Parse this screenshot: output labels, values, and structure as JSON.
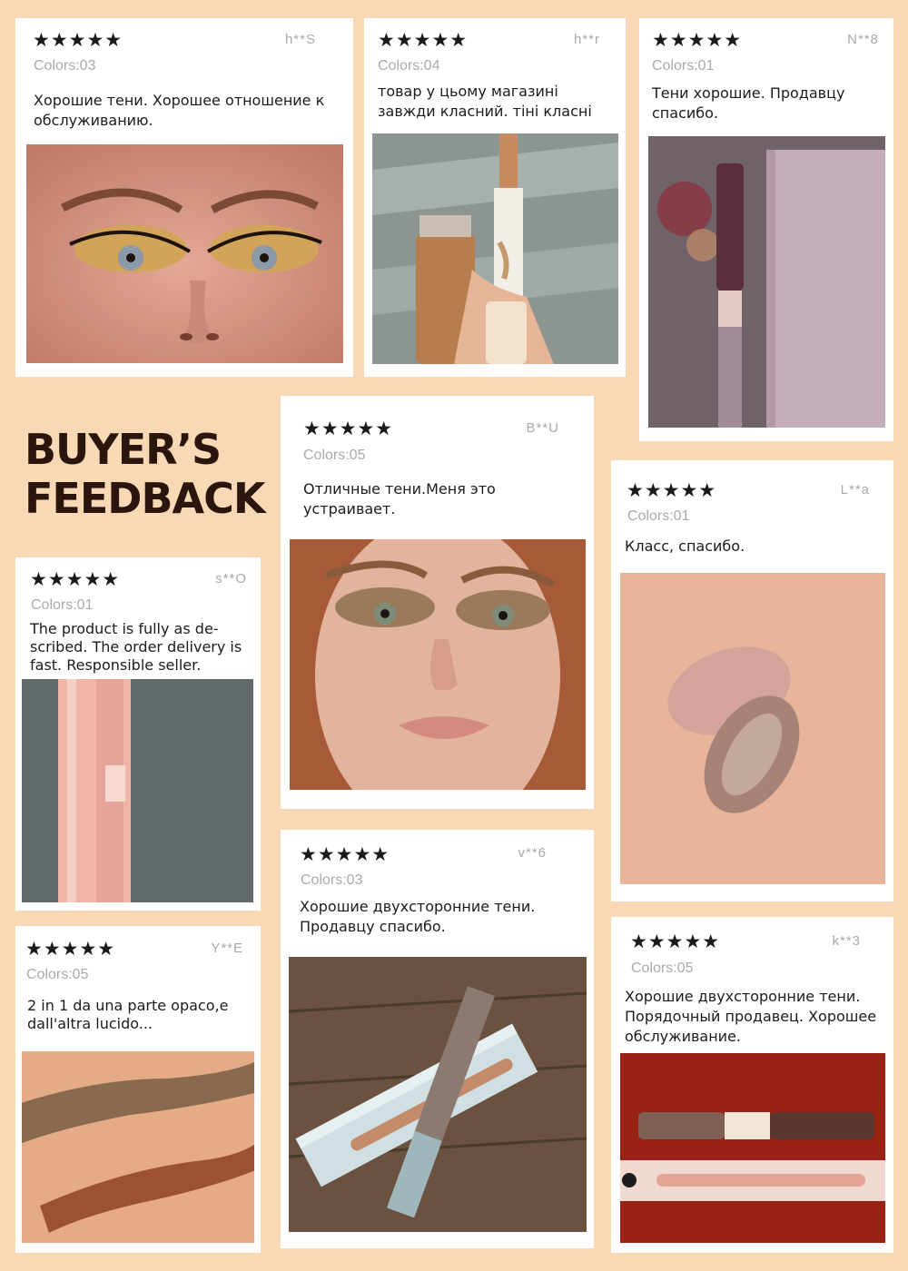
{
  "headline": {
    "line1": "BUYER’S",
    "line2": "FEEDBACK"
  },
  "colors": {
    "background": "#f9d8b5",
    "card": "#ffffff",
    "stars": "#1a1a1a",
    "headline": "#2b160d"
  },
  "reviews": [
    {
      "stars": "★★★★★",
      "rating": 5,
      "user": "h**S",
      "colors": "Colors:03",
      "text": "Хорошие тени. Хорошее отношение к обслуживанию.",
      "photo_icon": "eye-makeup-photo"
    },
    {
      "stars": "★★★★★",
      "rating": 5,
      "user": "h**r",
      "colors": "Colors:04",
      "text": "товар у цьому магазині завжди класний. тіні класні",
      "photo_icon": "applicator-photo"
    },
    {
      "stars": "★★★★★",
      "rating": 5,
      "user": "N**8",
      "colors": "Colors:01",
      "text": "Тени хорошие. Продавцу спасибо.",
      "photo_icon": "product-box-photo"
    },
    {
      "stars": "★★★★★",
      "rating": 5,
      "user": "B**U",
      "colors": "Colors:05",
      "text": "Отличные тени.Меня это устраивает.",
      "photo_icon": "face-photo"
    },
    {
      "stars": "★★★★★",
      "rating": 5,
      "user": "L**a",
      "colors": "Colors:01",
      "text": "Класс, спасибо.",
      "photo_icon": "skin-swatch-photo"
    },
    {
      "stars": "★★★★★",
      "rating": 5,
      "user": "s**O",
      "colors": "Colors:01",
      "text": "The product is fully as de- scribed. The order delivery is fast. Responsible seller.",
      "photo_icon": "pink-box-photo"
    },
    {
      "stars": "★★★★★",
      "rating": 5,
      "user": "v**6",
      "colors": "Colors:03",
      "text": "Хорошие двухсторонние тени. Продавцу спасибо.",
      "photo_icon": "box-on-wood-photo"
    },
    {
      "stars": "★★★★★",
      "rating": 5,
      "user": "Y**E",
      "colors": "Colors:05",
      "text": "2 in 1 da una parte opaco,e dall'altra lucido...",
      "photo_icon": "swatch-arm-photo"
    },
    {
      "stars": "★★★★★",
      "rating": 5,
      "user": "k**3",
      "colors": "Colors:05",
      "text": "Хорошие двухсторонние тени. Порядочный продавец. Хорошее обслуживание.",
      "photo_icon": "tube-box-photo"
    }
  ]
}
